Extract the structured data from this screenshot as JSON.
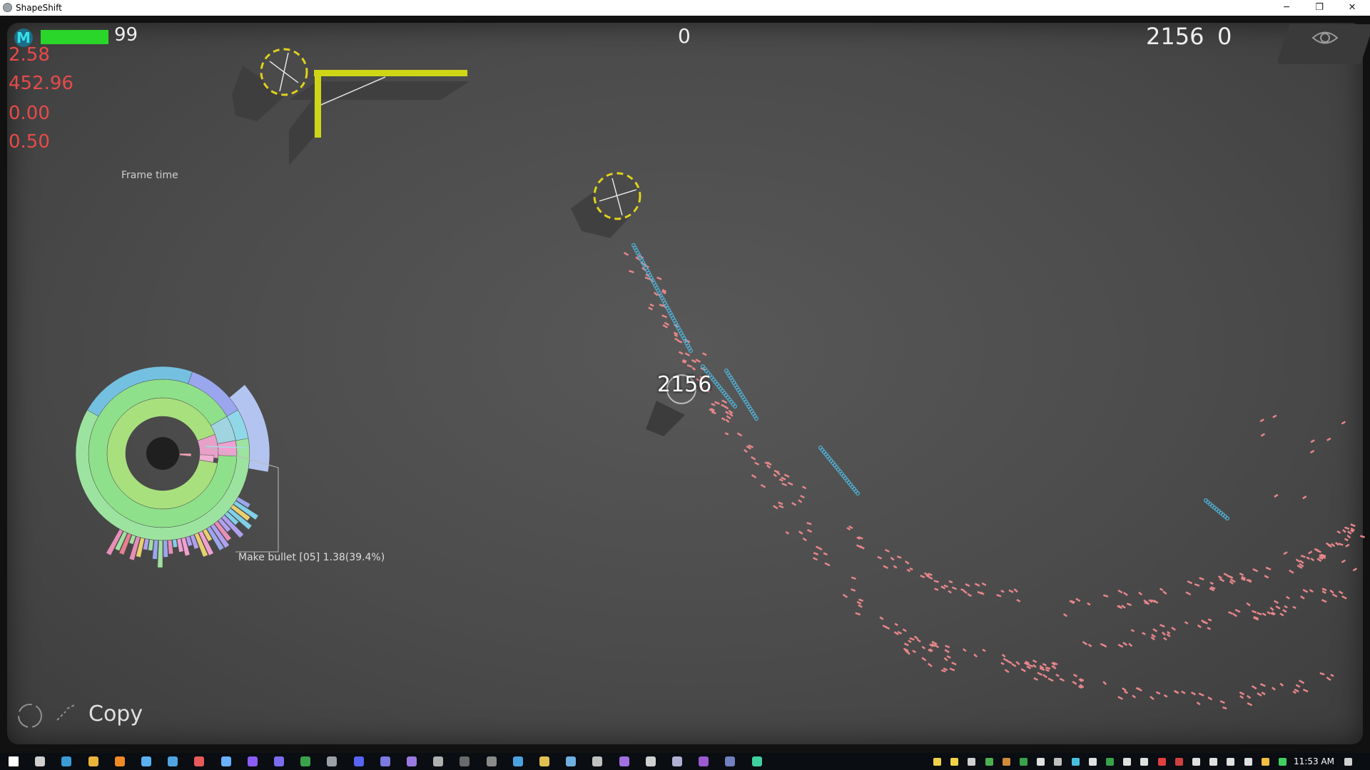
{
  "window": {
    "title": "ShapeShift",
    "minimize": "─",
    "restore": "❐",
    "close": "✕"
  },
  "hud": {
    "logo_letter": "M",
    "health_value": "99",
    "health_fraction": 0.99,
    "center_score": "0",
    "top_right_score": "2156",
    "top_right_extra": "0",
    "stats": [
      "2.58",
      "452.96",
      "0.00",
      "0.50"
    ],
    "frame_time_label": "Frame time",
    "player_score": "2156",
    "profiler_tooltip": "Make bullet [05]  1.38(39.4%)",
    "copy_label": "Copy",
    "eye_icon": "eye-icon"
  },
  "colors": {
    "health": "#2ad62a",
    "stats": "#e84a4a",
    "accent_yellow": "#d8e01a",
    "bullet_blue": "#4fb3d9",
    "bullet_pink": "#e7868a"
  },
  "taskbar": {
    "clock": "11:53 AM",
    "icons": [
      "windows-start",
      "task-view",
      "browser",
      "file-explorer",
      "media-player",
      "notepad",
      "editor",
      "chat",
      "steam",
      "visual-studio",
      "vs-code",
      "hex-editor",
      "terminal",
      "discord",
      "app-1",
      "app-2",
      "app-3",
      "app-4",
      "app-5",
      "app-6",
      "app-7",
      "app-8",
      "app-9",
      "app-10",
      "app-11",
      "app-12",
      "app-13",
      "app-14",
      "shapeshift"
    ],
    "tray_icons": [
      "tray-1",
      "tray-2",
      "tray-3",
      "tray-4",
      "tray-5",
      "tray-6",
      "tray-7",
      "tray-8",
      "tray-9",
      "tray-10",
      "tray-11",
      "tray-12",
      "tray-13",
      "tray-14",
      "tray-15",
      "tray-16",
      "tray-17",
      "tray-18",
      "tray-19",
      "tray-20",
      "tray-21"
    ]
  }
}
